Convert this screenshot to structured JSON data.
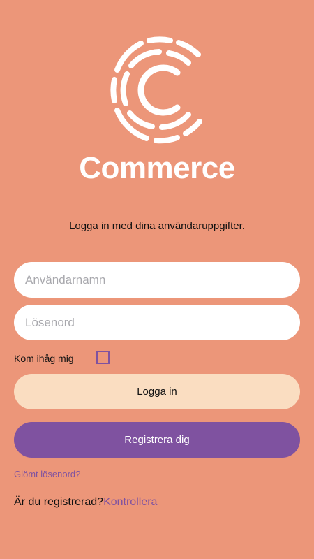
{
  "brand": {
    "logo_icon": "commerce-c-icon",
    "name": "Commerce"
  },
  "login": {
    "subtitle": "Logga in med dina användaruppgifter.",
    "username_placeholder": "Användarnamn",
    "username_value": "",
    "password_placeholder": "Lösenord",
    "password_value": "",
    "remember_label": "Kom ihåg mig",
    "remember_checked": false,
    "login_button": "Logga in",
    "register_button": "Registrera dig",
    "forgot_link": "Glömt lösenord?",
    "registered_question": "Är du registrerad?",
    "check_link": "Kontrollera"
  },
  "colors": {
    "background": "#EC9679",
    "accent": "#7F52A0",
    "login_button": "#FADDC1",
    "input_background": "#FFFFFF",
    "logo": "#FFFFFF"
  }
}
